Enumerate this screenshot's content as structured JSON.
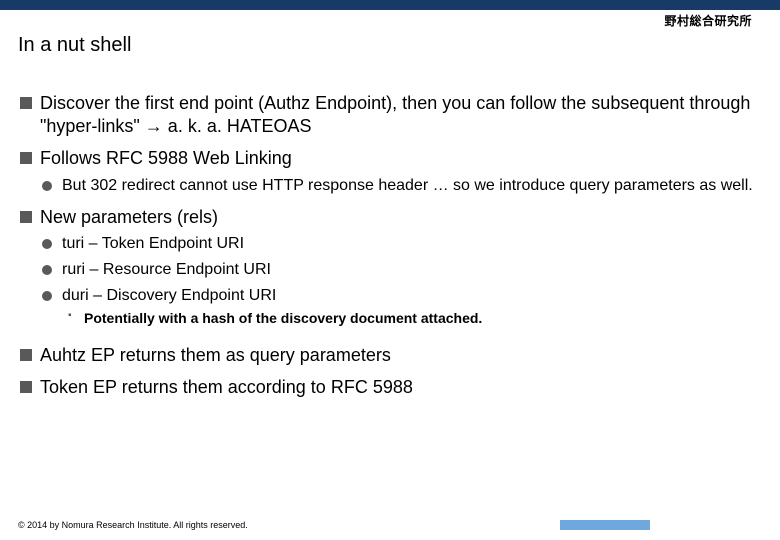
{
  "logo": "野村総合研究所",
  "title": "In a nut shell",
  "bullets": {
    "b1": "Discover the first end point (Authz Endpoint), then you can follow the subsequent through \"hyper-links\" → a. k. a. HATEOAS",
    "b2": "Follows RFC 5988 Web Linking",
    "b2_1": "But 302 redirect cannot use HTTP response header … so we introduce query parameters as well.",
    "b3": "New parameters (rels)",
    "b3_1": "turi – Token Endpoint URI",
    "b3_2": "ruri – Resource Endpoint URI",
    "b3_3": "duri – Discovery Endpoint URI",
    "b3_3_1": "Potentially with a hash of the discovery document attached.",
    "b4": "Auhtz EP returns them as query parameters",
    "b5": "Token EP returns them according to RFC 5988"
  },
  "footer": "© 2014 by Nomura Research Institute. All rights reserved."
}
